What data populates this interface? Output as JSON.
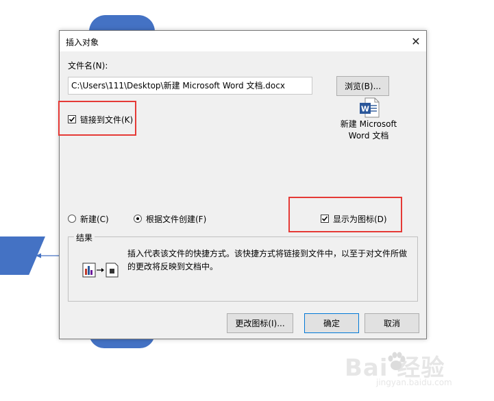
{
  "dialog": {
    "title": "插入对象",
    "close_glyph": "✕",
    "filename_label": "文件名(N):",
    "filename_value": "C:\\Users\\111\\Desktop\\新建 Microsoft Word 文档.docx",
    "browse_button": "浏览(B)...",
    "link_checkbox": {
      "label": "链接到文件(K)",
      "checked": true
    },
    "file_icon": {
      "icon": "word-document-icon",
      "label_line1": "新建 Microsoft",
      "label_line2": "Word 文档"
    },
    "radio_new": {
      "label": "新建(C)",
      "selected": false
    },
    "radio_from_file": {
      "label": "根据文件创建(F)",
      "selected": true
    },
    "display_as_icon": {
      "label": "显示为图标(D)",
      "checked": true
    },
    "result": {
      "legend": "结果",
      "text": "插入代表该文件的快捷方式。该快捷方式将链接到文件中，以至于对文件所做的更改将反映到文档中。"
    },
    "change_icon_button": "更改图标(I)...",
    "ok_button": "确定",
    "cancel_button": "取消"
  },
  "watermark": {
    "main": "Bai 经验",
    "sub": "jingyan.baidu.com"
  },
  "colors": {
    "accent": "#4472c4",
    "highlight": "#e53935",
    "dialog_bg": "#f0f0f0"
  }
}
